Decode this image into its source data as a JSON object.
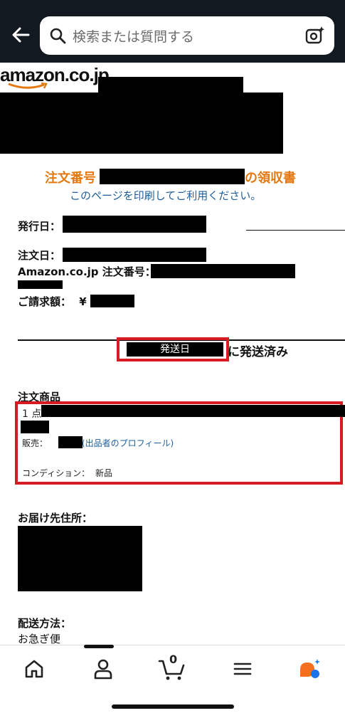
{
  "search": {
    "placeholder": "検索または質問する"
  },
  "logo": {
    "text": "amazon.co.jp"
  },
  "receipt": {
    "title_prefix": "注文番号",
    "title_suffix": "の領収書",
    "print_link": "このページを印刷してご利用ください。",
    "issue_date_label": "発行日：",
    "order_date_label": "注文日：",
    "order_number_label": "Amazon.co.jp 注文番号：",
    "billing_label": "ご請求額：",
    "billing_currency": "¥"
  },
  "shipment": {
    "date_placeholder": "発送日",
    "status_text": "に発送済み"
  },
  "items": {
    "section_label": "注文商品",
    "quantity": "1 点",
    "seller_label": "販売：",
    "seller_profile_link": "(出品者のプロフィール)",
    "condition_label": "コンディション：",
    "condition_value": "新品"
  },
  "shipping": {
    "address_label": "お届け先住所：",
    "method_label": "配送方法：",
    "method_value": "お急ぎ便"
  },
  "nav": {
    "cart_count": "0"
  },
  "colors": {
    "topbar": "#131921",
    "accent_orange": "#e47911",
    "link_blue": "#1f5d99",
    "highlight_red": "#d81b23"
  }
}
